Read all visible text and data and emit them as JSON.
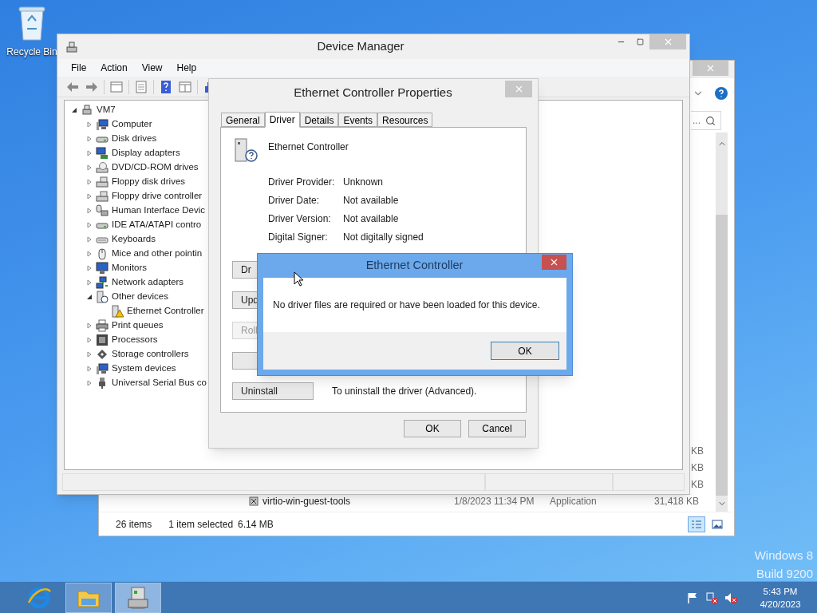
{
  "desktop": {
    "icons": [
      {
        "label": "Recycle Bin"
      }
    ],
    "edition_lines": [
      "Windows 8",
      "Build 9200"
    ]
  },
  "explorer_window": {
    "search": {
      "text": "..."
    },
    "size_fragments": [
      "KB",
      "KB",
      "KB"
    ],
    "files": [
      {
        "name": "virtio-win-guest-tools",
        "date": "1/8/2023 11:34 PM",
        "type": "Application",
        "size": "31,418 KB"
      }
    ],
    "status_bar": {
      "count": "26 items",
      "selection": "1 item selected",
      "size": "6.14 MB"
    },
    "views": [
      {
        "kind": "details",
        "selected": true
      },
      {
        "kind": "thumbnails",
        "selected": false
      }
    ]
  },
  "device_manager": {
    "title": "Device Manager",
    "menu": [
      "File",
      "Action",
      "View",
      "Help"
    ],
    "tree": [
      {
        "label": "VM7",
        "kind": "root",
        "expanded": true,
        "children": [
          {
            "label": "Computer",
            "kind": "computer",
            "expanded": false
          },
          {
            "label": "Disk drives",
            "kind": "disk",
            "expanded": false
          },
          {
            "label": "Display adapters",
            "kind": "display",
            "expanded": false
          },
          {
            "label": "DVD/CD-ROM drives",
            "kind": "optical",
            "expanded": false
          },
          {
            "label": "Floppy disk drives",
            "kind": "floppy",
            "expanded": false
          },
          {
            "label": "Floppy drive controller",
            "kind": "floppy",
            "expanded": false
          },
          {
            "label": "Human Interface Devic",
            "kind": "hid",
            "expanded": false
          },
          {
            "label": "IDE ATA/ATAPI contro",
            "kind": "disk",
            "expanded": false
          },
          {
            "label": "Keyboards",
            "kind": "keyboard",
            "expanded": false
          },
          {
            "label": "Mice and other pointin",
            "kind": "mouse",
            "expanded": false
          },
          {
            "label": "Monitors",
            "kind": "monitor",
            "expanded": false
          },
          {
            "label": "Network adapters",
            "kind": "network",
            "expanded": false
          },
          {
            "label": "Other devices",
            "kind": "other",
            "expanded": true,
            "children": [
              {
                "label": "Ethernet Controller",
                "kind": "warning"
              }
            ]
          },
          {
            "label": "Print queues",
            "kind": "printer",
            "expanded": false
          },
          {
            "label": "Processors",
            "kind": "processor",
            "expanded": false
          },
          {
            "label": "Storage controllers",
            "kind": "storage",
            "expanded": false
          },
          {
            "label": "System devices",
            "kind": "computer",
            "expanded": false
          },
          {
            "label": "Universal Serial Bus co",
            "kind": "usb",
            "expanded": false
          }
        ]
      }
    ]
  },
  "properties_dialog": {
    "title": "Ethernet Controller Properties",
    "tabs": [
      {
        "label": "General",
        "selected": false
      },
      {
        "label": "Driver",
        "selected": true
      },
      {
        "label": "Details",
        "selected": false
      },
      {
        "label": "Events",
        "selected": false
      },
      {
        "label": "Resources",
        "selected": false
      }
    ],
    "device_name": "Ethernet Controller",
    "fields": [
      {
        "label": "Driver Provider:",
        "value": "Unknown"
      },
      {
        "label": "Driver Date:",
        "value": "Not available"
      },
      {
        "label": "Driver Version:",
        "value": "Not available"
      },
      {
        "label": "Digital Signer:",
        "value": "Not digitally signed"
      }
    ],
    "buttons": [
      {
        "label": "Dr",
        "disabled": false
      },
      {
        "label": "Upd",
        "disabled": false
      },
      {
        "label": "Roll",
        "disabled": true
      },
      {
        "disabled": false
      },
      {
        "label": "Uninstall",
        "disabled": false,
        "description": "To uninstall the driver (Advanced)."
      }
    ],
    "footer_buttons": [
      "OK",
      "Cancel"
    ]
  },
  "message_box": {
    "title": "Ethernet Controller",
    "message": "No driver files are required or have been loaded for this device.",
    "button": "OK"
  },
  "taskbar": {
    "apps": [
      {
        "kind": "browser",
        "running": false,
        "selected": false
      },
      {
        "kind": "folder",
        "running": true,
        "selected": false
      },
      {
        "kind": "device-manager",
        "running": true,
        "selected": true
      }
    ],
    "clock": {
      "time": "5:43 PM",
      "date": "4/20/2023"
    }
  }
}
